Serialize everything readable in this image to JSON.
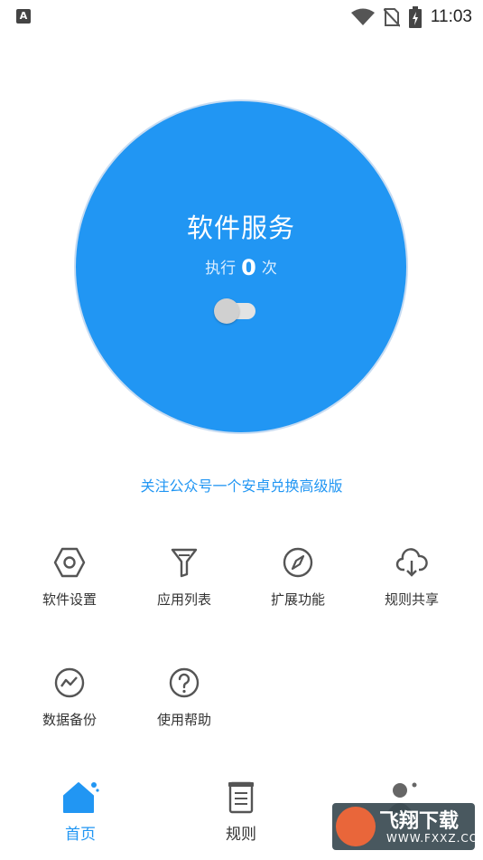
{
  "status_bar": {
    "time": "11:03",
    "left_icon": "A"
  },
  "service": {
    "title": "软件服务",
    "count_prefix": "执行",
    "count": "0",
    "count_suffix": "次"
  },
  "promo_text": "关注公众号一个安卓兑换高级版",
  "grid": [
    {
      "label": "软件设置",
      "icon": "hexagon-settings-icon"
    },
    {
      "label": "应用列表",
      "icon": "filter-icon"
    },
    {
      "label": "扩展功能",
      "icon": "compass-icon"
    },
    {
      "label": "规则共享",
      "icon": "cloud-download-icon"
    },
    {
      "label": "数据备份",
      "icon": "chart-circle-icon"
    },
    {
      "label": "使用帮助",
      "icon": "help-circle-icon"
    }
  ],
  "nav": [
    {
      "label": "首页",
      "active": true
    },
    {
      "label": "规则",
      "active": false
    },
    {
      "label": "",
      "active": false
    }
  ],
  "watermark": {
    "title": "飞翔下载",
    "url": "WWW.FXXZ.COM"
  },
  "colors": {
    "accent": "#2196f3",
    "text": "#333333"
  }
}
